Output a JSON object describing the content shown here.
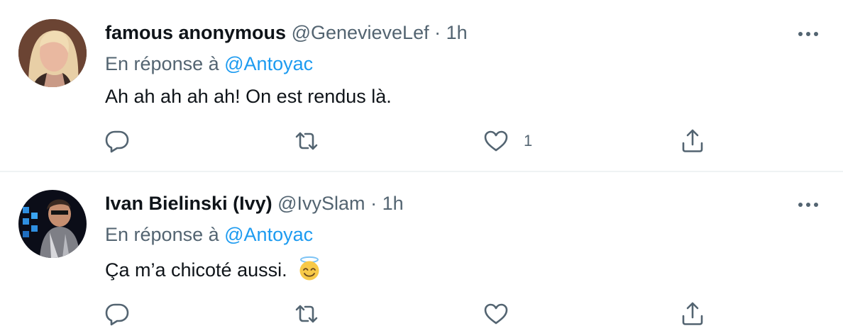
{
  "tweets": [
    {
      "display_name": "famous anonymous",
      "handle": "@GenevieveLef",
      "separator": "·",
      "time": "1h",
      "reply_prefix": "En réponse à",
      "reply_mention": "@Antoyac",
      "text": "Ah ah ah ah ah! On est rendus là.",
      "like_count": "1"
    },
    {
      "display_name": "Ivan Bielinski (Ivy)",
      "handle": "@IvySlam",
      "separator": "·",
      "time": "1h",
      "reply_prefix": "En réponse à",
      "reply_mention": "@Antoyac",
      "text": "Ça m’a chicoté aussi.",
      "emoji": "smiling-face-with-halo"
    }
  ],
  "icons": {
    "reply": "reply-icon",
    "retweet": "retweet-icon",
    "like": "like-icon",
    "share": "share-icon",
    "more": "more-icon"
  },
  "colors": {
    "text": "#0f1419",
    "secondary": "#536471",
    "link": "#1d9bf0",
    "divider": "#eff3f4"
  }
}
